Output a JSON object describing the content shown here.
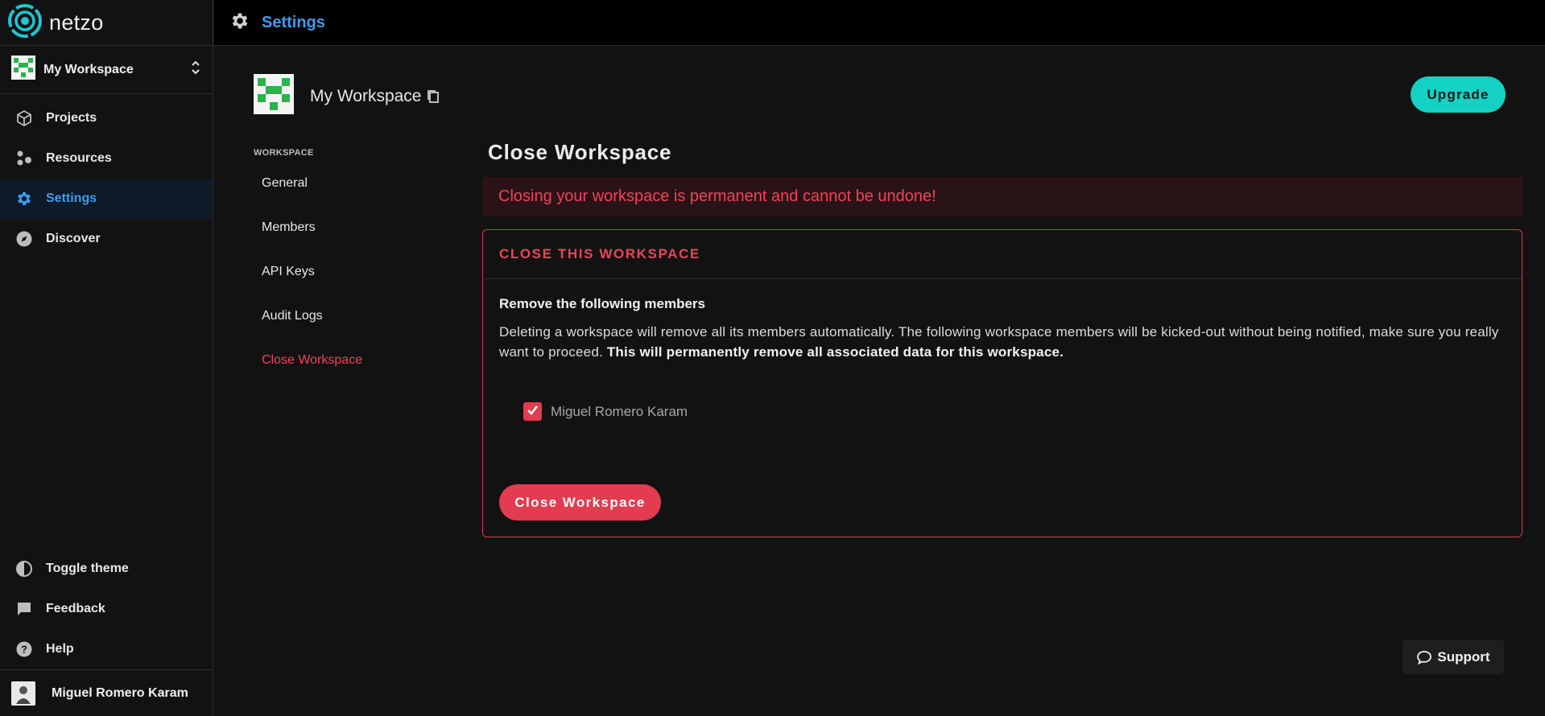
{
  "app": {
    "brand": "netzo",
    "page_title": "Settings"
  },
  "sidebar": {
    "workspace_switcher": {
      "name": "My Workspace"
    },
    "nav": [
      {
        "label": "Projects",
        "icon": "cube-icon"
      },
      {
        "label": "Resources",
        "icon": "resources-icon"
      },
      {
        "label": "Settings",
        "icon": "gear-icon",
        "active": true
      },
      {
        "label": "Discover",
        "icon": "compass-icon"
      }
    ],
    "bottom": [
      {
        "label": "Toggle theme",
        "icon": "contrast-icon"
      },
      {
        "label": "Feedback",
        "icon": "feedback-icon"
      },
      {
        "label": "Help",
        "icon": "help-icon"
      }
    ],
    "user": {
      "name": "Miguel Romero Karam"
    }
  },
  "workspace": {
    "name": "My Workspace",
    "upgrade_label": "Upgrade"
  },
  "subnav": {
    "heading": "WORKSPACE",
    "items": [
      "General",
      "Members",
      "API Keys",
      "Audit Logs",
      "Close Workspace"
    ]
  },
  "close_section": {
    "title": "Close Workspace",
    "alert": "Closing your workspace is permanent and cannot be undone!",
    "card_title": "CLOSE THIS WORKSPACE",
    "subtitle": "Remove the following members",
    "description": "Deleting a workspace will remove all its members automatically. The following workspace members will be kicked-out without being notified, make sure you really want to proceed.",
    "description_bold": "This will permanently remove all associated data for this workspace.",
    "members": [
      {
        "name": "Miguel Romero Karam",
        "checked": true
      }
    ],
    "button_label": "Close Workspace"
  },
  "support": {
    "label": "Support"
  },
  "colors": {
    "accent_blue": "#3d9cf0",
    "teal": "#13d1c4",
    "danger": "#e33b4f",
    "background": "#121212"
  }
}
